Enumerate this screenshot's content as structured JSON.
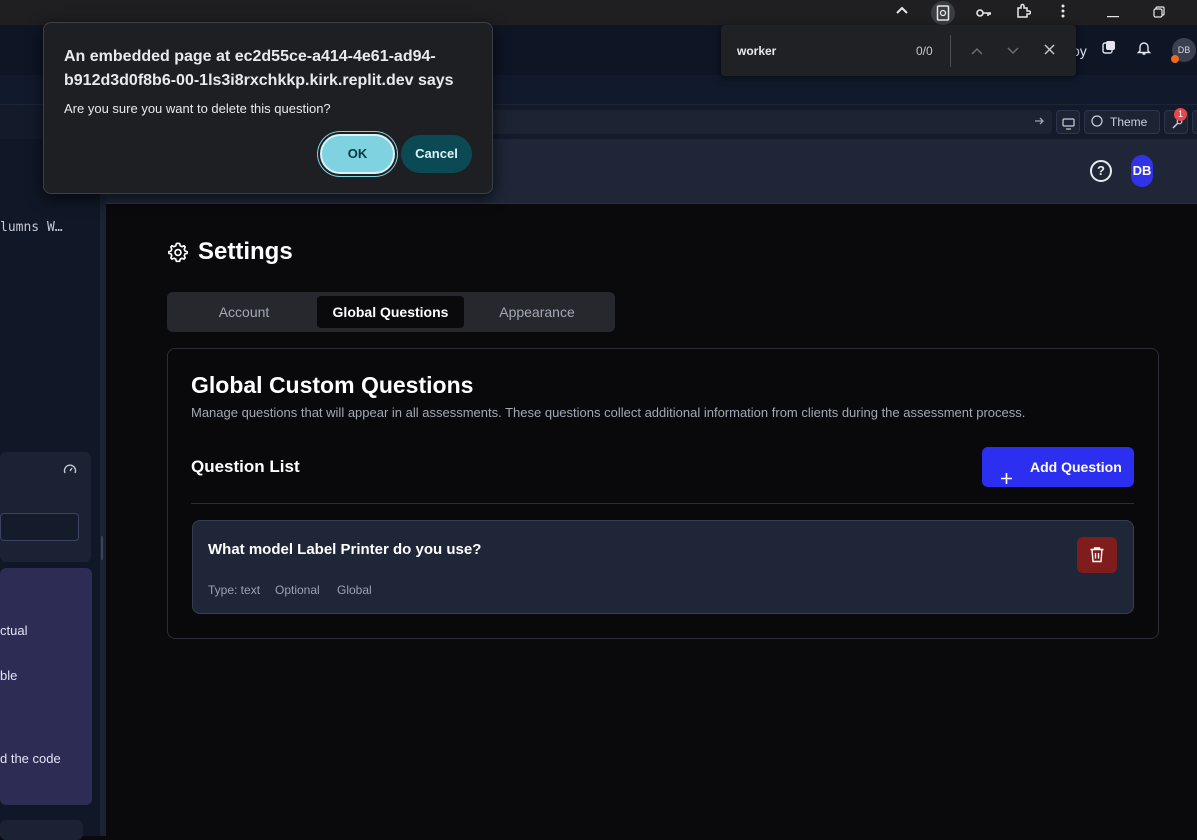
{
  "dialog": {
    "title": "An embedded page at ec2d55ce-a414-4e61-ad94-b912d3d0f8b6-00-1ls3i8rxchkkp.kirk.replit.dev says",
    "message": "Are you sure you want to delete this question?",
    "ok_label": "OK",
    "cancel_label": "Cancel"
  },
  "find_bar": {
    "query": "worker",
    "count": "0/0"
  },
  "top_bar": {
    "partial_label": "oy",
    "avatar_initials": "DB",
    "notification_badge": "1",
    "theme_label": "Theme"
  },
  "left_panel": {
    "code_snippet": "lumns W…",
    "texts": [
      "ctual",
      "ble",
      "d the code"
    ]
  },
  "app_header": {
    "avatar_initials": "DB",
    "help_icon": "?"
  },
  "settings": {
    "title": "Settings",
    "tabs": [
      {
        "label": "Account",
        "active": false
      },
      {
        "label": "Global Questions",
        "active": true
      },
      {
        "label": "Appearance",
        "active": false
      }
    ]
  },
  "global_questions": {
    "title": "Global Custom Questions",
    "description": "Manage questions that will appear in all assessments. These questions collect additional information from clients during the assessment process.",
    "list_title": "Question List",
    "add_button_label": "Add Question",
    "questions": [
      {
        "text": "What model Label Printer do you use?",
        "type": "Type: text",
        "required": "Optional",
        "scope": "Global"
      }
    ]
  },
  "colors": {
    "accent": "#2d2ff0",
    "delete": "#7f1d1d",
    "dialog_ok": "#7fd2e0",
    "dialog_cancel": "#0b4a55"
  }
}
